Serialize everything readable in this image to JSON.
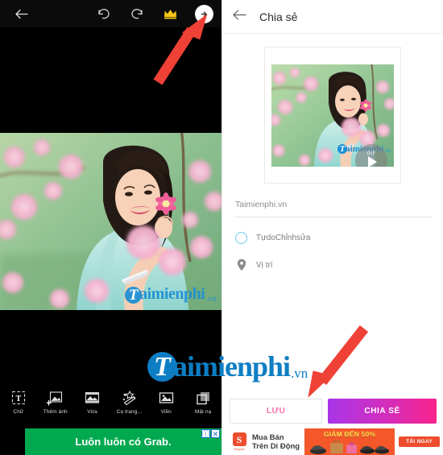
{
  "editor": {
    "toolbar": {
      "back_icon": "arrow-left-icon",
      "undo_icon": "undo-icon",
      "redo_icon": "redo-icon",
      "premium_icon": "crown-icon",
      "next_icon": "arrow-right-circle-icon",
      "next_label": "›"
    },
    "tools": [
      {
        "label": "Chữ",
        "icon": "text-tool-icon"
      },
      {
        "label": "Thêm ảnh",
        "icon": "add-photo-icon"
      },
      {
        "label": "Vừa",
        "icon": "fit-icon"
      },
      {
        "label": "Cọ trang...",
        "icon": "magic-wand-icon"
      },
      {
        "label": "Viền",
        "icon": "border-icon"
      },
      {
        "label": "Mặt nạ",
        "icon": "mask-icon"
      }
    ],
    "ad": {
      "text": "Luôn luôn có Grab.",
      "badge_info": "ⓘ",
      "badge_close": "✕",
      "bg_color": "#00a94f"
    },
    "watermark": {
      "logo": "T",
      "name": "aimienphi",
      "tld": ".vn"
    }
  },
  "share": {
    "header": {
      "back_icon": "arrow-left-icon",
      "title": "Chia sẻ"
    },
    "preview": {
      "gif_label": "GIF",
      "play_icon": "play-icon",
      "watermark": {
        "logo": "T",
        "name": "aimienphi",
        "tld": ".vn"
      }
    },
    "caption": {
      "value": "Taimienphi.vn",
      "placeholder": "Taimienphi.vn"
    },
    "options": [
      {
        "label": "TựdoChỉnhsửa",
        "icon": "circle-outline-icon",
        "color": "#6cc9e8"
      },
      {
        "label": "Vị trí",
        "icon": "location-pin-icon",
        "color": "#8c8c8c"
      }
    ],
    "actions": {
      "save_label": "LƯU",
      "share_label": "CHIA SẺ",
      "save_text_color": "#f56ea8",
      "share_gradient_start": "#a935e8",
      "share_gradient_end": "#f9238c"
    },
    "ad": {
      "brand": "Shopee",
      "brand_letter": "S",
      "line1": "Mua Bán",
      "line2": "Trên Di Động",
      "promo": "GIẢM ĐẾN 50%",
      "cta": "TẢI NGAY",
      "accent_color": "#ee4d2d"
    }
  },
  "annotations": {
    "arrow_color": "#ef4136",
    "arrow_top_target": "next-button",
    "arrow_bottom_target": "save-button"
  },
  "center_watermark": {
    "logo": "T",
    "name": "aimienphi",
    "tld": ".vn"
  }
}
